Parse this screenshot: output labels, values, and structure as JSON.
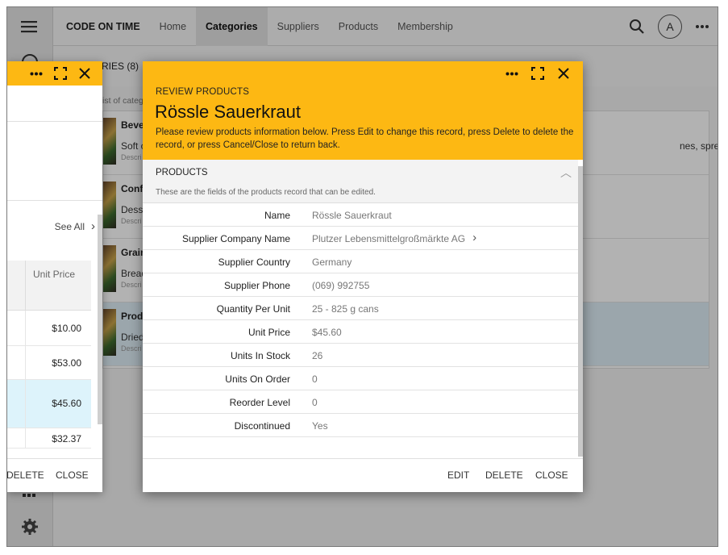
{
  "app": {
    "brand": "CODE ON TIME",
    "nav": [
      "Home",
      "Categories",
      "Suppliers",
      "Products",
      "Membership"
    ],
    "active_nav": "Categories",
    "avatar_letter": "A",
    "toolbar_partial": "RIES (8)",
    "list_caption_partial": "ist of categ"
  },
  "background_list": [
    {
      "title": "Beve",
      "subtitle": "Soft c",
      "desc": "Descri",
      "trail": "nes, spreads, and seasonings"
    },
    {
      "title": "Conf",
      "subtitle": "Desse",
      "desc": "Descri",
      "trail": ""
    },
    {
      "title": "Grain",
      "subtitle": "Bread",
      "desc": "Descri",
      "trail": ""
    },
    {
      "title": "Prod",
      "subtitle": "Dried",
      "desc": "Descri",
      "trail": ""
    }
  ],
  "left_dialog": {
    "see_all": "See All",
    "grid_header": "Unit Price",
    "prices": [
      "$10.00",
      "$53.00",
      "$45.60",
      "$32.37"
    ],
    "delete_label": "DELETE",
    "close_label": "CLOSE"
  },
  "dialog": {
    "eyebrow": "REVIEW PRODUCTS",
    "title": "Rössle Sauerkraut",
    "instructions": "Please review products information below. Press Edit to change this record, press Delete to delete the record, or press Cancel/Close to return back.",
    "section_title": "PRODUCTS",
    "section_desc": "These are the fields of the products record that can be edited.",
    "fields": [
      {
        "label": "Name",
        "value": "Rössle Sauerkraut"
      },
      {
        "label": "Supplier Company Name",
        "value": "Plutzer Lebensmittelgroßmärkte AG"
      },
      {
        "label": "Supplier Country",
        "value": "Germany"
      },
      {
        "label": "Supplier Phone",
        "value": "(069) 992755"
      },
      {
        "label": "Quantity Per Unit",
        "value": "25 - 825 g cans"
      },
      {
        "label": "Unit Price",
        "value": "$45.60"
      },
      {
        "label": "Units In Stock",
        "value": "26"
      },
      {
        "label": "Units On Order",
        "value": "0"
      },
      {
        "label": "Reorder Level",
        "value": "0"
      },
      {
        "label": "Discontinued",
        "value": "Yes"
      }
    ],
    "buttons": {
      "edit": "EDIT",
      "delete": "DELETE",
      "close": "CLOSE"
    }
  },
  "colors": {
    "accent": "#fdb813",
    "selected_row": "#ddf3fb"
  },
  "icons": [
    "menu-icon",
    "search-icon",
    "more-icon",
    "fullscreen-icon",
    "close-icon",
    "chevron-right-icon",
    "chevron-up-icon",
    "grid-icon",
    "gear-icon"
  ]
}
